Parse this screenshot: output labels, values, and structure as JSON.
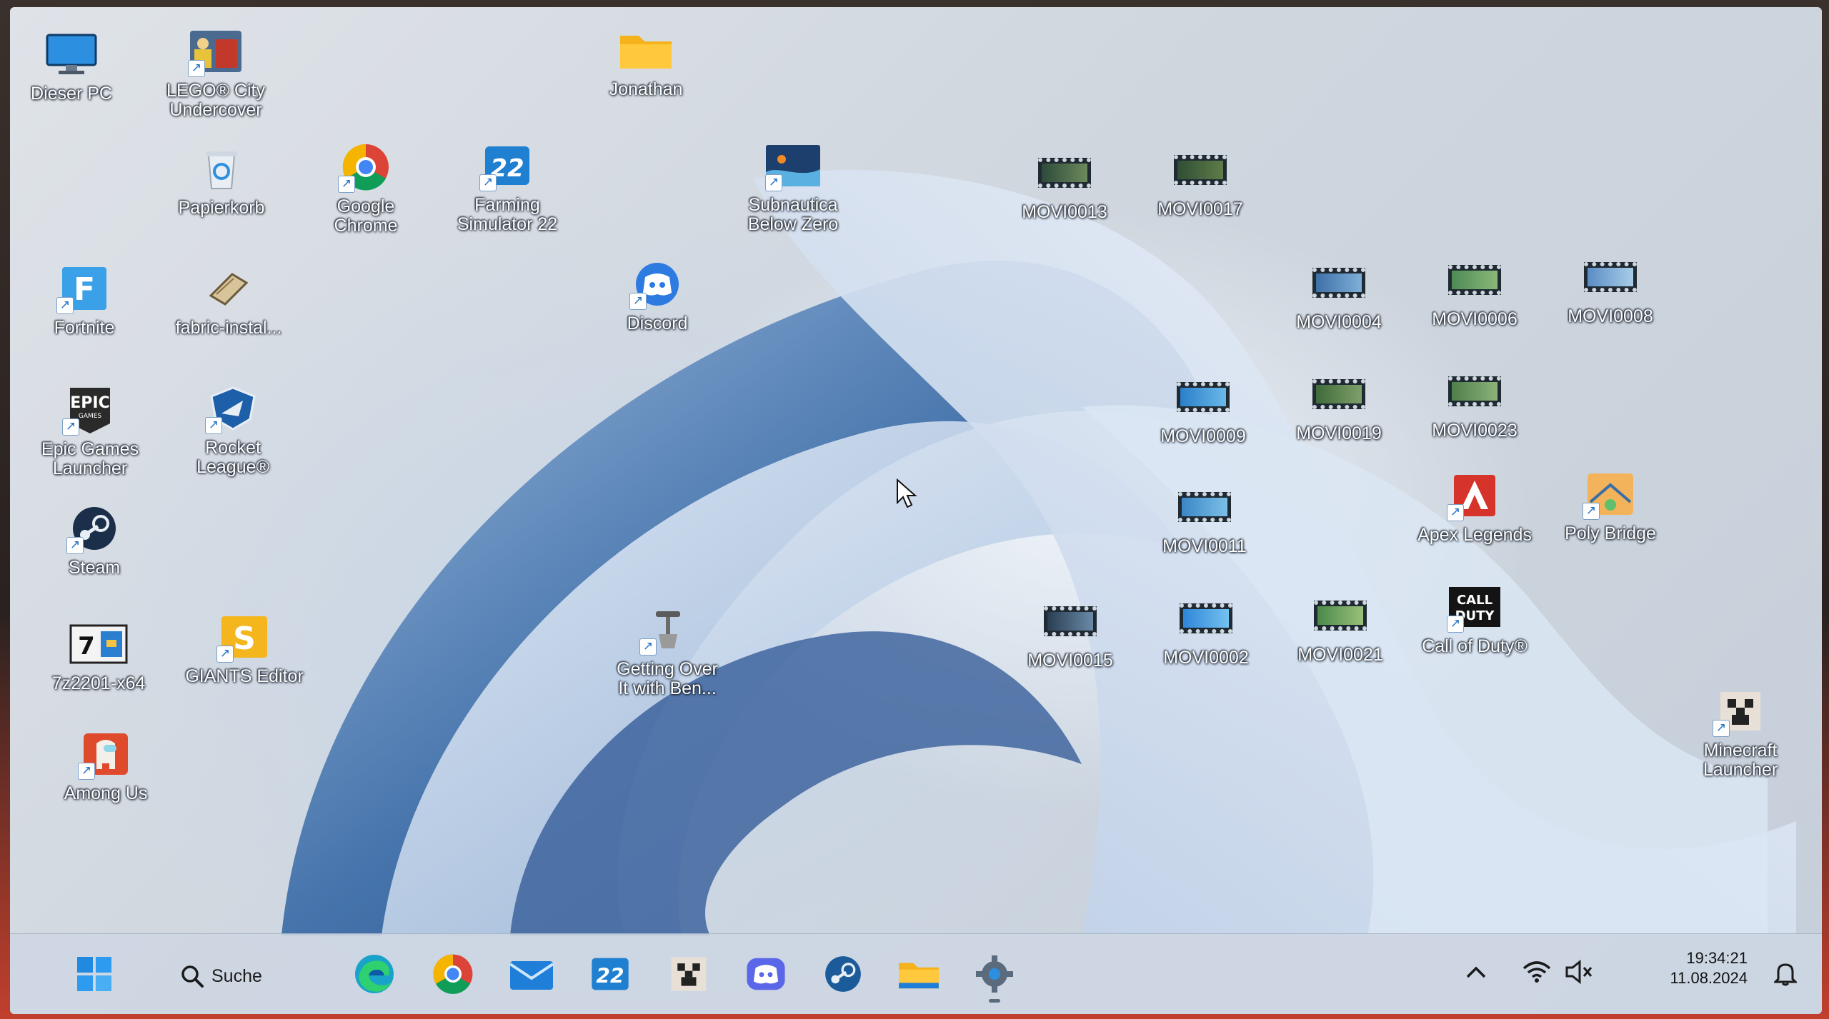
{
  "desktop": {
    "icons": [
      {
        "label": "Dieser PC",
        "icon": "computer-icon"
      },
      {
        "label": "LEGO® City\nUndercover",
        "icon": "lego-city-icon"
      },
      {
        "label": "Jonathan",
        "icon": "folder-icon"
      },
      {
        "label": "Papierkorb",
        "icon": "recycle-bin-icon"
      },
      {
        "label": "Google\nChrome",
        "icon": "chrome-icon"
      },
      {
        "label": "Farming\nSimulator 22",
        "icon": "farming-simulator-icon"
      },
      {
        "label": "Subnautica\nBelow Zero",
        "icon": "subnautica-icon"
      },
      {
        "label": "MOVI0013",
        "icon": "video-file-icon"
      },
      {
        "label": "MOVI0017",
        "icon": "video-file-icon"
      },
      {
        "label": "Fortnite",
        "icon": "fortnite-icon"
      },
      {
        "label": "fabric-instal...",
        "icon": "fabric-installer-icon"
      },
      {
        "label": "Discord",
        "icon": "discord-icon"
      },
      {
        "label": "MOVI0004",
        "icon": "video-file-icon"
      },
      {
        "label": "MOVI0006",
        "icon": "video-file-icon"
      },
      {
        "label": "MOVI0008",
        "icon": "video-file-icon"
      },
      {
        "label": "Epic Games\nLauncher",
        "icon": "epic-games-icon"
      },
      {
        "label": "Rocket\nLeague®",
        "icon": "rocket-league-icon"
      },
      {
        "label": "MOVI0009",
        "icon": "video-file-icon"
      },
      {
        "label": "MOVI0019",
        "icon": "video-file-icon"
      },
      {
        "label": "MOVI0023",
        "icon": "video-file-icon"
      },
      {
        "label": "Steam",
        "icon": "steam-icon"
      },
      {
        "label": "MOVI0011",
        "icon": "video-file-icon"
      },
      {
        "label": "Apex Legends",
        "icon": "apex-legends-icon"
      },
      {
        "label": "Poly Bridge",
        "icon": "poly-bridge-icon"
      },
      {
        "label": "7z2201-x64",
        "icon": "7zip-icon"
      },
      {
        "label": "GIANTS Editor",
        "icon": "giants-editor-icon"
      },
      {
        "label": "Getting Over\nIt with Ben...",
        "icon": "getting-over-it-icon"
      },
      {
        "label": "MOVI0015",
        "icon": "video-file-icon"
      },
      {
        "label": "MOVI0002",
        "icon": "video-file-icon"
      },
      {
        "label": "MOVI0021",
        "icon": "video-file-icon"
      },
      {
        "label": "Call of Duty®",
        "icon": "call-of-duty-icon"
      },
      {
        "label": "Minecraft\nLauncher",
        "icon": "minecraft-icon"
      },
      {
        "label": "Among Us",
        "icon": "among-us-icon"
      }
    ]
  },
  "taskbar": {
    "search_label": "Suche",
    "pinned": [
      {
        "name": "edge",
        "icon": "edge-icon"
      },
      {
        "name": "chrome",
        "icon": "chrome-icon"
      },
      {
        "name": "mail",
        "icon": "mail-icon"
      },
      {
        "name": "farming-simulator",
        "icon": "farming-simulator-icon"
      },
      {
        "name": "minecraft",
        "icon": "minecraft-icon"
      },
      {
        "name": "discord",
        "icon": "discord-icon"
      },
      {
        "name": "steam",
        "icon": "steam-icon"
      },
      {
        "name": "file-explorer",
        "icon": "folder-icon"
      },
      {
        "name": "settings",
        "icon": "gear-icon"
      }
    ],
    "clock": {
      "time": "19:34:21",
      "date": "11.08.2024"
    }
  },
  "colors": {
    "accent": "#1f6fc4",
    "taskbar": "#cdd6e2",
    "wallpaper_blue": "#4a78b0"
  }
}
